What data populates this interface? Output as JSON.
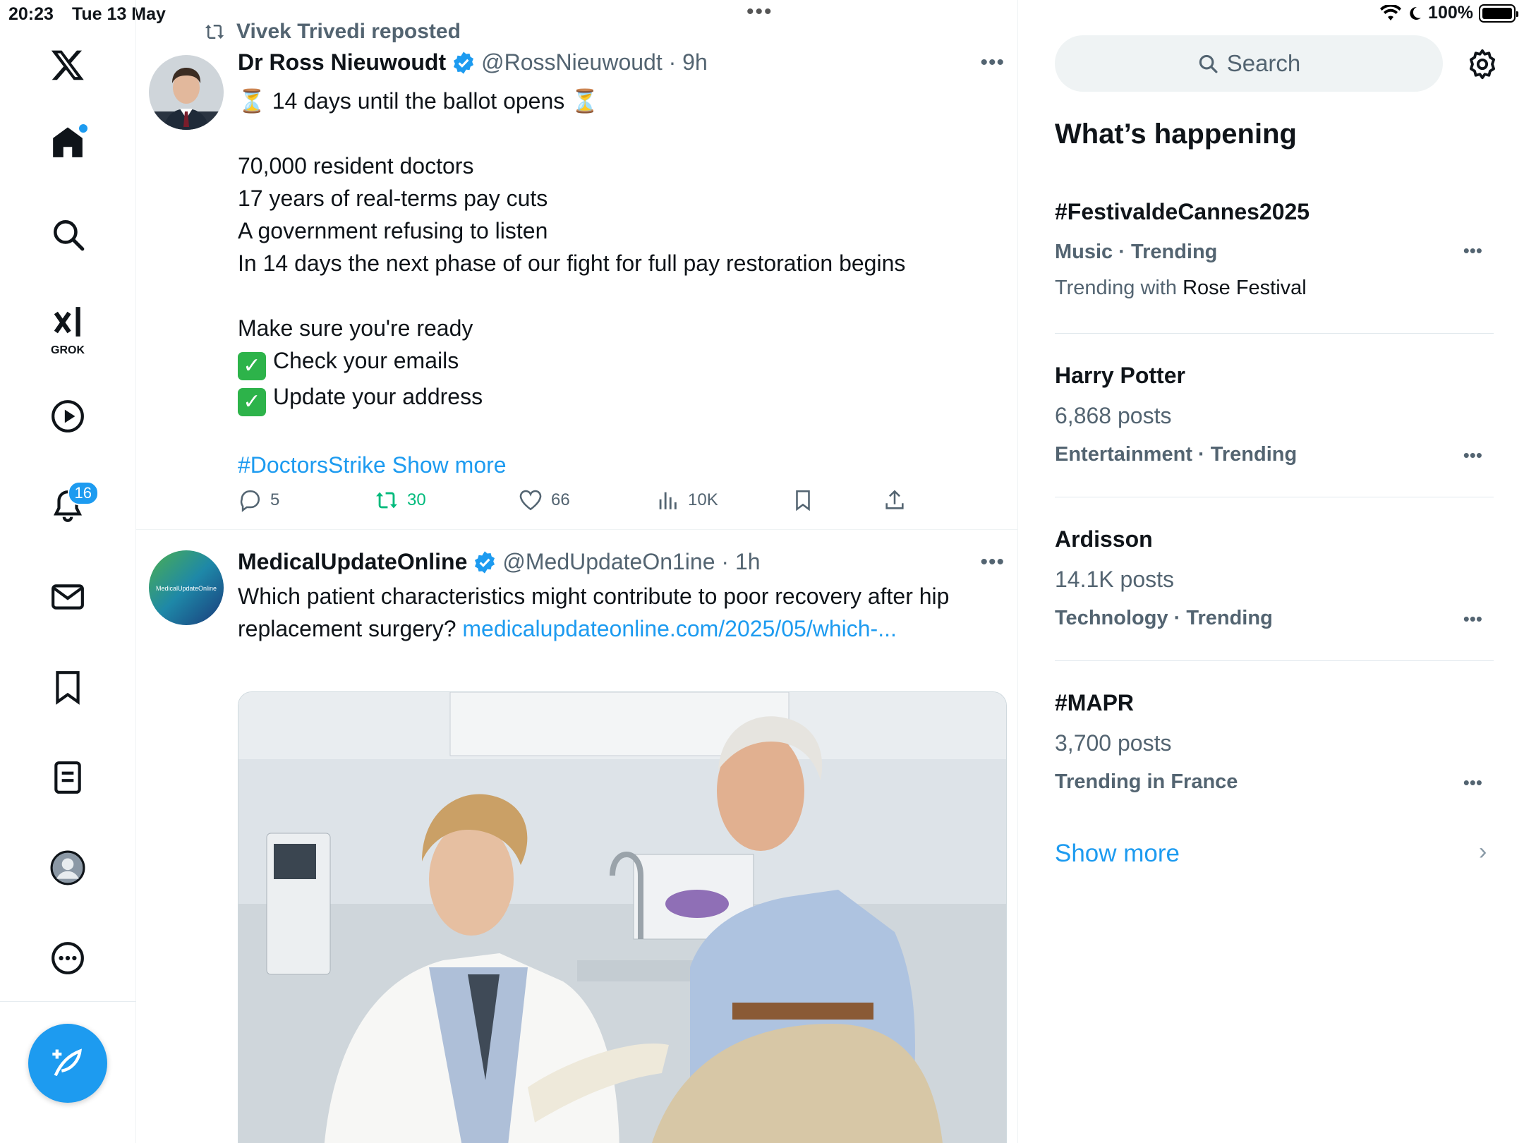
{
  "status_bar": {
    "time": "20:23",
    "date": "Tue 13 May",
    "battery": "100%"
  },
  "nav": {
    "notifications_badge": "16",
    "grok_label": "GROK"
  },
  "feed": {
    "repost": {
      "text": "Vivek Trivedi reposted"
    },
    "tweet1": {
      "name": "Dr Ross Nieuwoudt",
      "handle_time": "@RossNieuwoudt · 9h",
      "line1": "14 days until the ballot opens",
      "line2": "70,000 resident doctors",
      "line3": "17 years of real-terms pay cuts",
      "line4": "A government refusing to listen",
      "line5": "In 14 days the next phase of our fight for full pay restoration begins",
      "line6": "Make sure you're ready",
      "line7": "Check your emails",
      "line8": "Update your address",
      "hashtag": "#DoctorsStrike",
      "show_more": "Show more",
      "replies": "5",
      "reposts": "30",
      "likes": "66",
      "views": "10K"
    },
    "tweet2": {
      "name": "MedicalUpdateOnline",
      "avatar_text": "MedicalUpdateOnline",
      "handle_time": "@MedUpdateOn1ine · 1h",
      "text": "Which patient characteristics might contribute to poor recovery after hip replacement surgery?",
      "link": "medicalupdateonline.com/2025/05/which-..."
    }
  },
  "sidebar": {
    "search_placeholder": "Search",
    "title": "What’s happening",
    "trends": [
      {
        "name": "#FestivaldeCannes2025",
        "meta": "Music · Trending",
        "with_prefix": "Trending with",
        "with_value": "Rose Festival"
      },
      {
        "name": "Harry Potter",
        "posts": "6,868 posts",
        "meta": "Entertainment · Trending"
      },
      {
        "name": "Ardisson",
        "posts": "14.1K posts",
        "meta": "Technology · Trending"
      },
      {
        "name": "#MAPR",
        "posts": "3,700 posts",
        "meta": "Trending in France"
      }
    ],
    "show_more": "Show more"
  },
  "colors": {
    "accent": "#1d9bf0",
    "repost_green": "#00ba7c",
    "secondary_text": "#536471"
  }
}
